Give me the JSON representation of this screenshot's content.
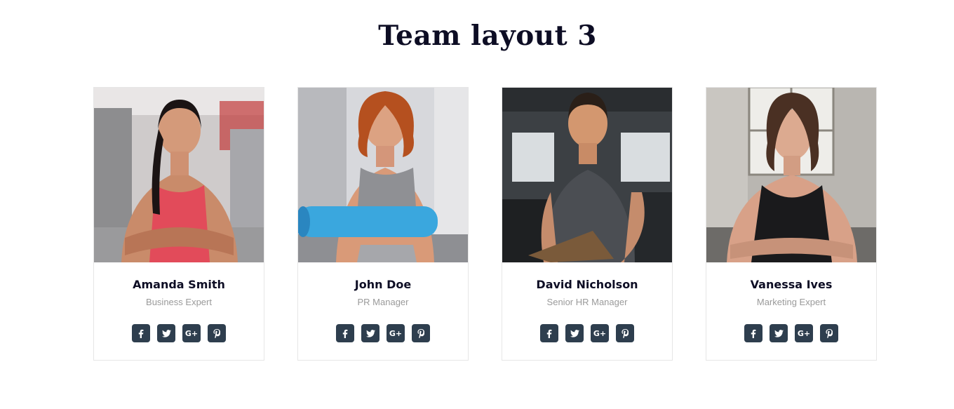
{
  "page": {
    "title": "Team  layout 3"
  },
  "team": [
    {
      "name": "Amanda Smith",
      "role": "Business Expert",
      "photo_icon": "woman-red-top-photo",
      "socials": [
        "facebook-icon",
        "twitter-icon",
        "google-plus-icon",
        "pinterest-icon"
      ]
    },
    {
      "name": "John Doe",
      "role": "PR Manager",
      "photo_icon": "woman-gray-top-with-mat-photo",
      "socials": [
        "facebook-icon",
        "twitter-icon",
        "google-plus-icon",
        "pinterest-icon"
      ]
    },
    {
      "name": "David Nicholson",
      "role": "Senior HR Manager",
      "photo_icon": "man-with-clipboard-photo",
      "socials": [
        "facebook-icon",
        "twitter-icon",
        "google-plus-icon",
        "pinterest-icon"
      ]
    },
    {
      "name": "Vanessa Ives",
      "role": "Marketing Expert",
      "photo_icon": "woman-black-top-photo",
      "socials": [
        "facebook-icon",
        "twitter-icon",
        "google-plus-icon",
        "pinterest-icon"
      ]
    }
  ],
  "social_labels": {
    "google_plus": "G+"
  },
  "colors": {
    "title": "#0d0d24",
    "social_button": "#2e3e4e",
    "role_text": "#9a9a9a",
    "card_border": "#e6e6e6"
  }
}
